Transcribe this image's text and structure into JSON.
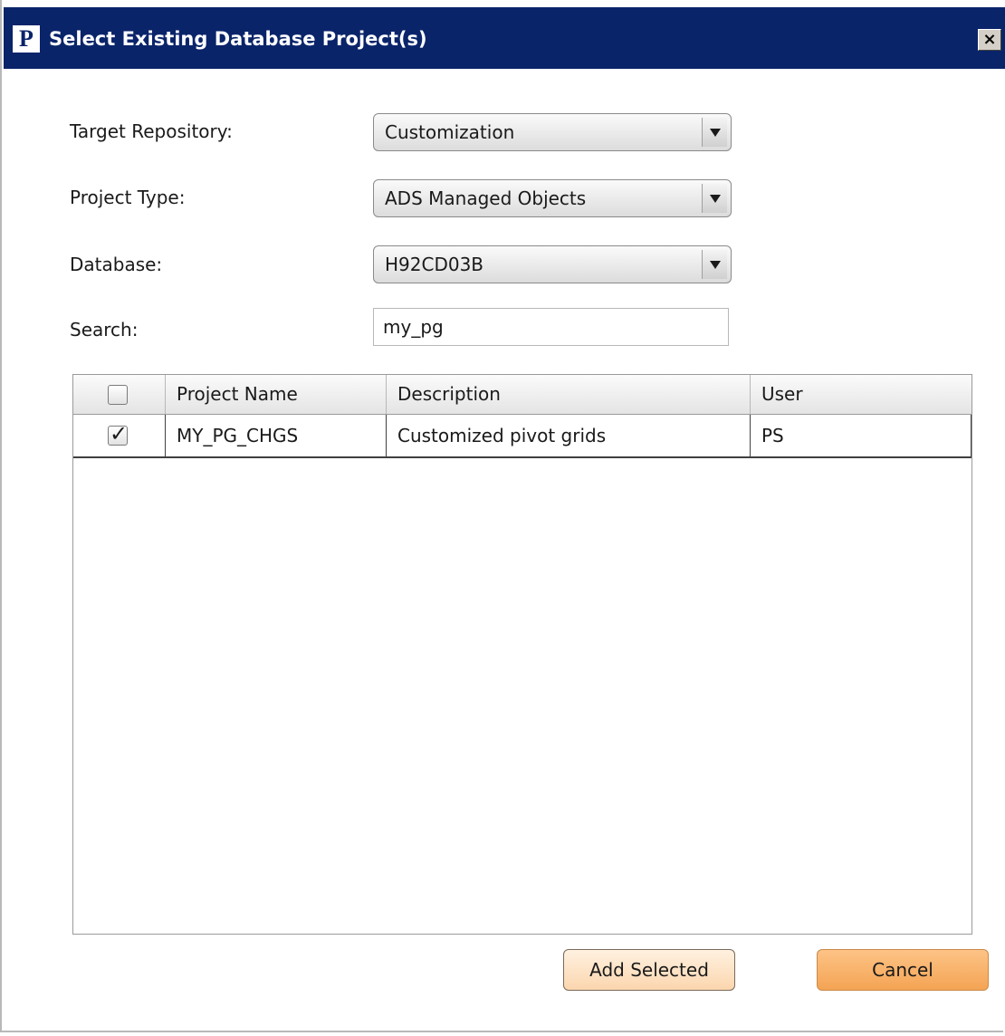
{
  "window": {
    "title": "Select Existing Database Project(s)",
    "app_icon_letter": "P",
    "close_glyph": "×"
  },
  "form": {
    "target_repository": {
      "label": "Target Repository:",
      "value": "Customization"
    },
    "project_type": {
      "label": "Project Type:",
      "value": "ADS Managed Objects"
    },
    "database": {
      "label": "Database:",
      "value": "H92CD03B"
    },
    "search": {
      "label": "Search:",
      "value": "my_pg"
    }
  },
  "table": {
    "columns": [
      "",
      "Project Name",
      "Description",
      "User"
    ],
    "select_all_checked": false,
    "rows": [
      {
        "checked": true,
        "check_glyph": "✓",
        "project_name": "MY_PG_CHGS",
        "description": "Customized pivot grids",
        "user": "PS"
      }
    ]
  },
  "buttons": {
    "add_selected": "Add Selected",
    "cancel": "Cancel"
  },
  "colors": {
    "titlebar": "#0a246a",
    "add_button": "#fbd6ae",
    "cancel_button": "#f4a454"
  }
}
